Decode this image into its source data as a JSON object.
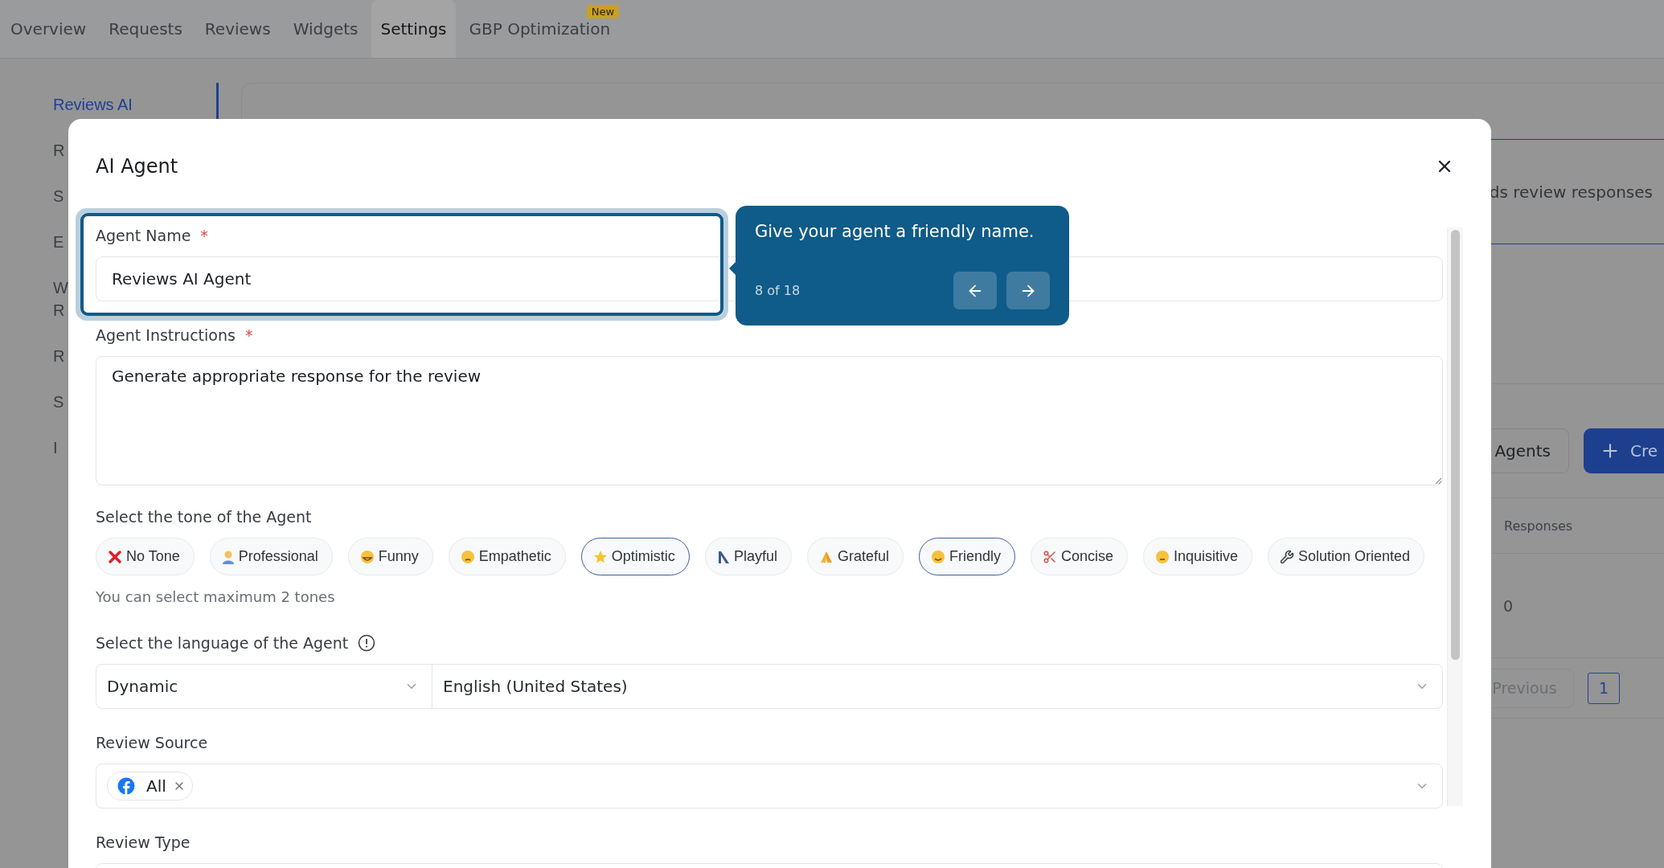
{
  "nav_tabs": [
    {
      "label": "Overview",
      "selected": false
    },
    {
      "label": "Requests",
      "selected": false
    },
    {
      "label": "Reviews",
      "selected": false
    },
    {
      "label": "Widgets",
      "selected": false
    },
    {
      "label": "Settings",
      "selected": true
    },
    {
      "label": "GBP Optimization",
      "selected": false,
      "badge": "New"
    }
  ],
  "sidebar": {
    "items": [
      {
        "label": "Reviews AI",
        "selected": true
      },
      {
        "label": "R",
        "selected": false
      },
      {
        "label": "S",
        "selected": false
      },
      {
        "label": "E",
        "selected": false
      },
      {
        "label": "W R",
        "selected": false
      },
      {
        "label": "R",
        "selected": false
      },
      {
        "label": "S",
        "selected": false
      },
      {
        "label": "I",
        "selected": false
      }
    ]
  },
  "background": {
    "description": "ds review responses",
    "agents_button": "Agents",
    "create_button": "Cre",
    "table": {
      "columns": [
        "Responses"
      ],
      "rows": [
        [
          "0"
        ]
      ]
    },
    "pagination": {
      "previous": "Previous",
      "pages": [
        {
          "label": "1",
          "selected": true
        }
      ]
    }
  },
  "modal": {
    "title": "AI Agent",
    "agent_name": {
      "label": "Agent Name",
      "required_mark": "*",
      "value": "Reviews AI Agent"
    },
    "instructions": {
      "label": "Agent Instructions",
      "required_mark": "*",
      "value": "Generate appropriate response for the review"
    },
    "tone": {
      "label": "Select the tone of the Agent",
      "hint": "You can select maximum 2 tones",
      "options": [
        {
          "label": "No Tone",
          "selected": false
        },
        {
          "label": "Professional",
          "selected": false
        },
        {
          "label": "Funny",
          "selected": false
        },
        {
          "label": "Empathetic",
          "selected": false
        },
        {
          "label": "Optimistic",
          "selected": true
        },
        {
          "label": "Playful",
          "selected": false
        },
        {
          "label": "Grateful",
          "selected": false
        },
        {
          "label": "Friendly",
          "selected": true
        },
        {
          "label": "Concise",
          "selected": false
        },
        {
          "label": "Inquisitive",
          "selected": false
        },
        {
          "label": "Solution Oriented",
          "selected": false
        }
      ]
    },
    "language": {
      "label": "Select the language of the Agent",
      "mode": "Dynamic",
      "value": "English (United States)"
    },
    "review_source": {
      "label": "Review Source",
      "chips": [
        "All"
      ]
    },
    "review_type": {
      "label": "Review Type"
    },
    "tour": {
      "text": "Give your agent a friendly name.",
      "step": "8 of 18"
    }
  }
}
